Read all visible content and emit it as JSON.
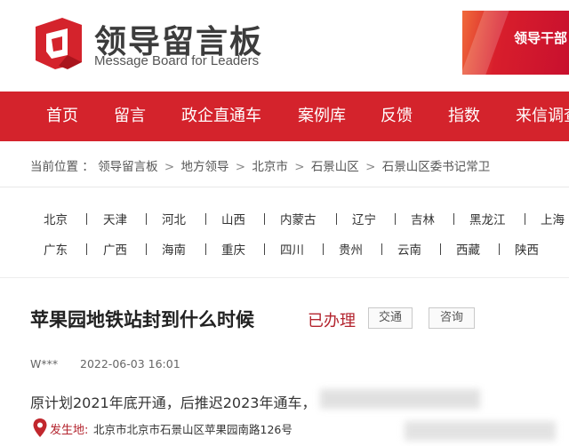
{
  "header": {
    "logo_cn": "领导留言板",
    "logo_en": "Message Board for Leaders",
    "banner_text": "领导干部"
  },
  "nav": {
    "items": [
      "首页",
      "留言",
      "政企直通车",
      "案例库",
      "反馈",
      "指数",
      "来信调查"
    ]
  },
  "breadcrumb": {
    "label": "当前位置 ：",
    "items": [
      "领导留言板",
      "地方领导",
      "北京市",
      "石景山区",
      "石景山区委书记常卫"
    ],
    "separator": ">"
  },
  "regions": {
    "row1": [
      "北京",
      "天津",
      "河北",
      "山西",
      "内蒙古",
      "辽宁",
      "吉林",
      "黑龙江",
      "上海"
    ],
    "row2": [
      "广东",
      "广西",
      "海南",
      "重庆",
      "四川",
      "贵州",
      "云南",
      "西藏",
      "陕西"
    ]
  },
  "message": {
    "title": "苹果园地铁站封到什么时候",
    "status": "已办理",
    "tags": [
      "交通",
      "咨询"
    ],
    "user": "W***",
    "time": "2022-06-03 16:01",
    "body": "原计划2021年底开通，后推迟2023年通车，",
    "location_label": "发生地:",
    "location": "北京市北京市石景山区苹果园南路126号"
  },
  "colors": {
    "brand_red": "#d4232c",
    "status_red": "#b3242e"
  }
}
